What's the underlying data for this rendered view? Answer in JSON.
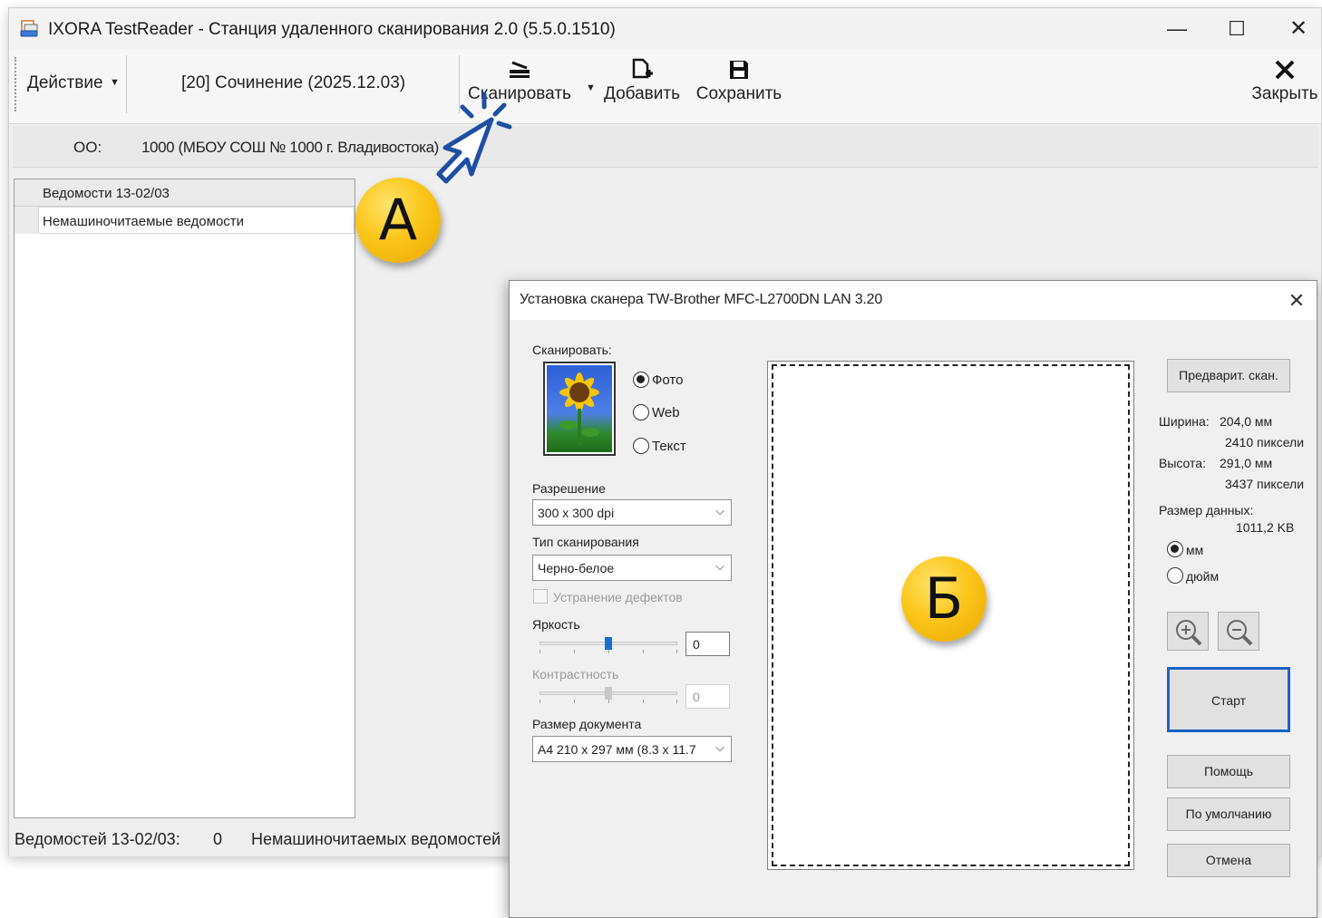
{
  "app": {
    "title": "IXORA TestReader - Станция удаленного сканирования 2.0 (5.5.0.1510)",
    "window_controls": {
      "minimize": "—",
      "maximize": "☐",
      "close": "✕"
    }
  },
  "toolbar": {
    "action_menu": "Действие",
    "document": "[20] Сочинение (2025.12.03)",
    "scan_label": "Сканировать",
    "add_label": "Добавить",
    "save_label": "Сохранить",
    "close_label": "Закрыть"
  },
  "org": {
    "label": "ОО:",
    "value": "1000 (МБОУ СОШ № 1000 г. Владивостока)"
  },
  "list": {
    "items": [
      "Ведомости 13-02/03",
      "Немашиночитаемые ведомости"
    ]
  },
  "status": {
    "items": [
      {
        "label": "Ведомостей 13-02/03:",
        "value": "0"
      },
      {
        "label": "Немашиночитаемых ведомостей"
      }
    ]
  },
  "annotations": {
    "badge_a": "А",
    "badge_b": "Б"
  },
  "scanner_dialog": {
    "title": "Установка сканера TW-Brother MFC-L2700DN LAN 3.20",
    "close": "✕",
    "scan_label": "Сканировать:",
    "scan_modes": [
      {
        "label": "Фото",
        "selected": true
      },
      {
        "label": "Web",
        "selected": false
      },
      {
        "label": "Текст",
        "selected": false
      }
    ],
    "resolution_label": "Разрешение",
    "resolution_value": "300 x 300 dpi",
    "scan_type_label": "Тип сканирования",
    "scan_type_value": "Черно-белое",
    "defects_label": "Устранение дефектов",
    "defects_checked": false,
    "brightness_label": "Яркость",
    "brightness_value": "0",
    "contrast_label": "Контрастность",
    "contrast_value": "0",
    "doc_size_label": "Размер документа",
    "doc_size_value": "A4 210 x 297 мм (8.3 x 11.7",
    "prescan_button": "Предварит. скан.",
    "width_label": "Ширина:",
    "width_mm": "204,0 мм",
    "width_px": "2410 пиксели",
    "height_label": "Высота:",
    "height_mm": "291,0 мм",
    "height_px": "3437 пиксели",
    "data_size_label": "Размер данных:",
    "data_size_value": "1011,2 KB",
    "units": [
      {
        "label": "мм",
        "selected": true
      },
      {
        "label": "дюйм",
        "selected": false
      }
    ],
    "start_button": "Старт",
    "help_button": "Помощь",
    "default_button": "По умолчанию",
    "cancel_button": "Отмена"
  },
  "icons": {
    "app": "scanner-app-icon",
    "scan": "scanner-icon",
    "add": "add-document-icon",
    "save": "floppy-disk-icon",
    "close": "close-icon",
    "zoom_in": "zoom-in-icon",
    "zoom_out": "zoom-out-icon",
    "cursor": "hand-pointer-cursor-icon"
  },
  "colors": {
    "accent_blue": "#1a62c7",
    "badge_yellow": "#fbc61a",
    "cursor_blue": "#1f4fa3"
  }
}
